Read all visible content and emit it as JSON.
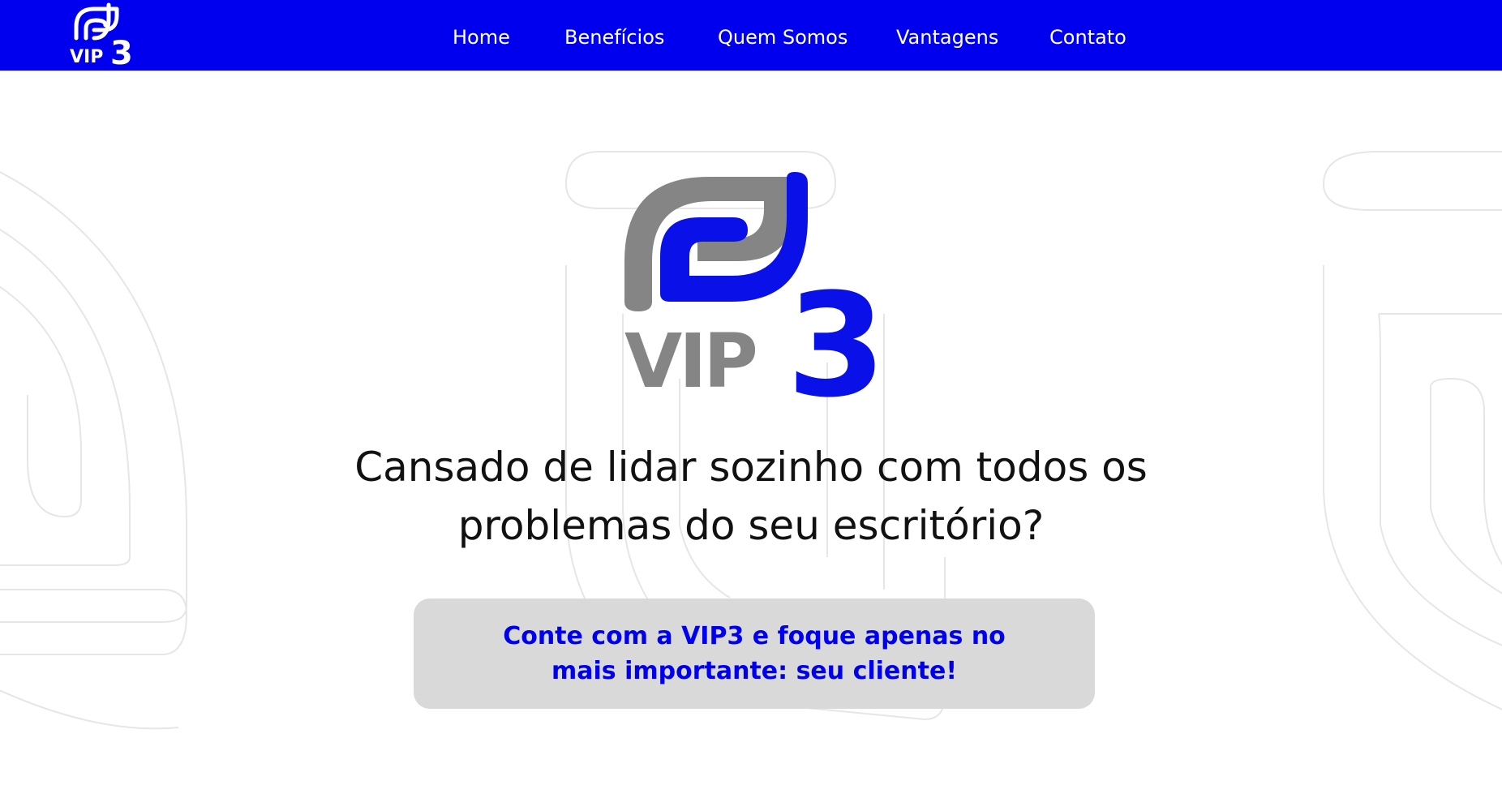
{
  "brand": {
    "name": "VIP3",
    "primary_color": "#0000ee",
    "logo_grey": "#858585",
    "nav_logo_icon": "vip3-logo-icon"
  },
  "nav": {
    "items": [
      {
        "label": "Home"
      },
      {
        "label": "Benefícios"
      },
      {
        "label": "Quem Somos"
      },
      {
        "label": "Vantagens"
      },
      {
        "label": "Contato"
      }
    ]
  },
  "hero": {
    "title": "Cansado de lidar sozinho com todos os problemas do seu escritório?",
    "cta_text": "Conte com a VIP3 e foque apenas no mais importante: seu cliente!",
    "cta_background": "#d9d9d9"
  }
}
